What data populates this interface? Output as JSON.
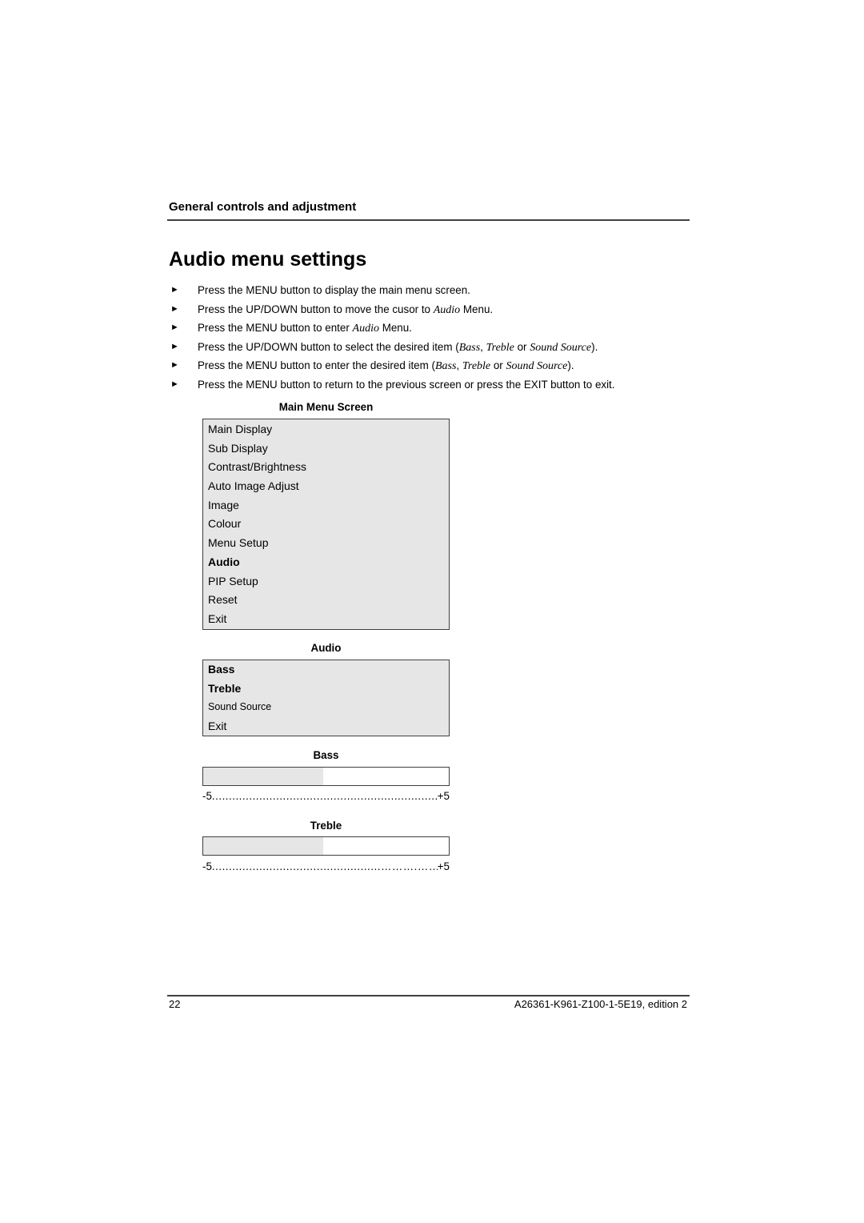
{
  "header": {
    "section_title": "General controls and adjustment"
  },
  "page_title": "Audio menu settings",
  "steps": [
    {
      "bullet": "►",
      "parts": [
        {
          "t": "Press the MENU button to display the main menu screen."
        }
      ]
    },
    {
      "bullet": "►",
      "parts": [
        {
          "t": "Press the UP/DOWN button to move the cusor to "
        },
        {
          "t": "Audio",
          "i": true
        },
        {
          "t": " Menu."
        }
      ]
    },
    {
      "bullet": "►",
      "parts": [
        {
          "t": "Press the MENU button to enter "
        },
        {
          "t": "Audio",
          "i": true
        },
        {
          "t": " Menu."
        }
      ]
    },
    {
      "bullet": "►",
      "parts": [
        {
          "t": "Press the UP/DOWN button to select the desired item ("
        },
        {
          "t": "Bass",
          "i": true
        },
        {
          "t": ", "
        },
        {
          "t": "Treble",
          "i": true
        },
        {
          "t": " or "
        },
        {
          "t": "Sound Source",
          "i": true
        },
        {
          "t": ")."
        }
      ]
    },
    {
      "bullet": "►",
      "parts": [
        {
          "t": "Press the MENU button to enter the desired item ("
        },
        {
          "t": "Bass",
          "i": true
        },
        {
          "t": ", "
        },
        {
          "t": "Treble",
          "i": true
        },
        {
          "t": " or "
        },
        {
          "t": "Sound Source",
          "i": true
        },
        {
          "t": ")."
        }
      ]
    },
    {
      "bullet": "►",
      "parts": [
        {
          "t": "Press the MENU button to return to the previous screen or press the EXIT button to exit."
        }
      ]
    }
  ],
  "main_menu": {
    "caption": "Main Menu Screen",
    "items": [
      {
        "label": "Main Display"
      },
      {
        "label": "Sub Display"
      },
      {
        "label": "Contrast/Brightness"
      },
      {
        "label": "Auto Image Adjust"
      },
      {
        "label": "Image"
      },
      {
        "label": "Colour"
      },
      {
        "label": "Menu Setup"
      },
      {
        "label": "Audio",
        "selected": true
      },
      {
        "label": "PIP Setup"
      },
      {
        "label": "Reset"
      },
      {
        "label": "Exit"
      }
    ]
  },
  "audio_menu": {
    "caption": "Audio",
    "items": [
      {
        "label": "Bass",
        "bold": true
      },
      {
        "label": "Treble",
        "bold": true
      },
      {
        "label": "Sound Source",
        "small": true
      },
      {
        "label": "Exit"
      }
    ]
  },
  "bass": {
    "caption": "Bass",
    "min_label": "-5",
    "max_label": "+5",
    "dots": "..........................................................................",
    "level_fraction": 0.49
  },
  "treble": {
    "caption": "Treble",
    "min_label": "-5",
    "max_label": "+5",
    "dots": "..................................................……….……..",
    "level_fraction": 0.49
  },
  "footer": {
    "page_number": "22",
    "doc_id": "A26361-K961-Z100-1-5E19, edition 2"
  }
}
